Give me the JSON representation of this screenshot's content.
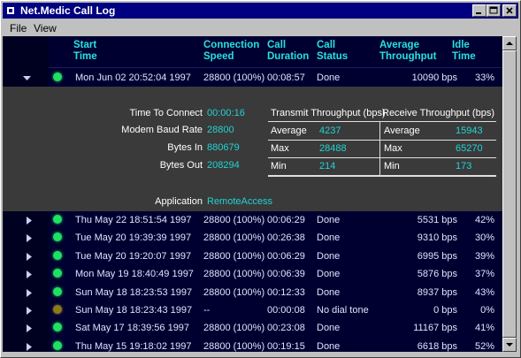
{
  "window": {
    "title": "Net.Medic Call Log"
  },
  "menu": {
    "file": "File",
    "view": "View"
  },
  "columns": {
    "start": [
      "Start",
      "Time"
    ],
    "speed": [
      "Connection",
      "Speed"
    ],
    "duration": [
      "Call",
      "Duration"
    ],
    "status": [
      "Call",
      "Status"
    ],
    "throughput": [
      "Average",
      "Throughput"
    ],
    "idle": [
      "Idle",
      "Time"
    ]
  },
  "expanded": {
    "start": "Mon Jun 02 20:52:04 1997",
    "speed": "28800 (100%)",
    "duration": "00:08:57",
    "status": "Done",
    "throughput": "10090 bps",
    "idle": "33%",
    "details": {
      "labels": [
        "Time To Connect",
        "Modem Baud Rate",
        "Bytes In",
        "Bytes Out",
        "Application"
      ],
      "values": [
        "00:00:16",
        "28800",
        "880679",
        "208294",
        "RemoteAccess"
      ],
      "transmit_header": "Transmit Throughput (bps)",
      "receive_header": "Receive Throughput (bps)",
      "stats": [
        {
          "label": "Average",
          "tx": "4237",
          "rx": "15943"
        },
        {
          "label": "Max",
          "tx": "28488",
          "rx": "65270"
        },
        {
          "label": "Min",
          "tx": "214",
          "rx": "173"
        }
      ]
    }
  },
  "rows": [
    {
      "start": "Thu May 22 18:51:54 1997",
      "speed": "28800 (100%)",
      "duration": "00:06:29",
      "status": "Done",
      "throughput": "5531 bps",
      "idle": "42%",
      "dot": "#1fe060"
    },
    {
      "start": "Tue May 20 19:39:39 1997",
      "speed": "28800 (100%)",
      "duration": "00:26:38",
      "status": "Done",
      "throughput": "9310 bps",
      "idle": "30%",
      "dot": "#1fe060"
    },
    {
      "start": "Tue May 20 19:20:07 1997",
      "speed": "28800 (100%)",
      "duration": "00:06:29",
      "status": "Done",
      "throughput": "6995 bps",
      "idle": "39%",
      "dot": "#1fe060"
    },
    {
      "start": "Mon May 19 18:40:49 1997",
      "speed": "28800 (100%)",
      "duration": "00:06:39",
      "status": "Done",
      "throughput": "5876 bps",
      "idle": "37%",
      "dot": "#1fe060"
    },
    {
      "start": "Sun May 18 18:23:53 1997",
      "speed": "28800 (100%)",
      "duration": "00:12:33",
      "status": "Done",
      "throughput": "8937 bps",
      "idle": "43%",
      "dot": "#1fe060"
    },
    {
      "start": "Sun May 18 18:23:43 1997",
      "speed": "--",
      "duration": "00:00:08",
      "status": "No dial tone",
      "throughput": "0 bps",
      "idle": "0%",
      "dot": "#8a7a20"
    },
    {
      "start": "Sat May 17 18:39:56 1997",
      "speed": "28800 (100%)",
      "duration": "00:23:08",
      "status": "Done",
      "throughput": "11167 bps",
      "idle": "41%",
      "dot": "#1fe060"
    },
    {
      "start": "Thu May 15 19:18:02 1997",
      "speed": "28800 (100%)",
      "duration": "00:19:15",
      "status": "Done",
      "throughput": "6618 bps",
      "idle": "52%",
      "dot": "#1fe060"
    }
  ]
}
